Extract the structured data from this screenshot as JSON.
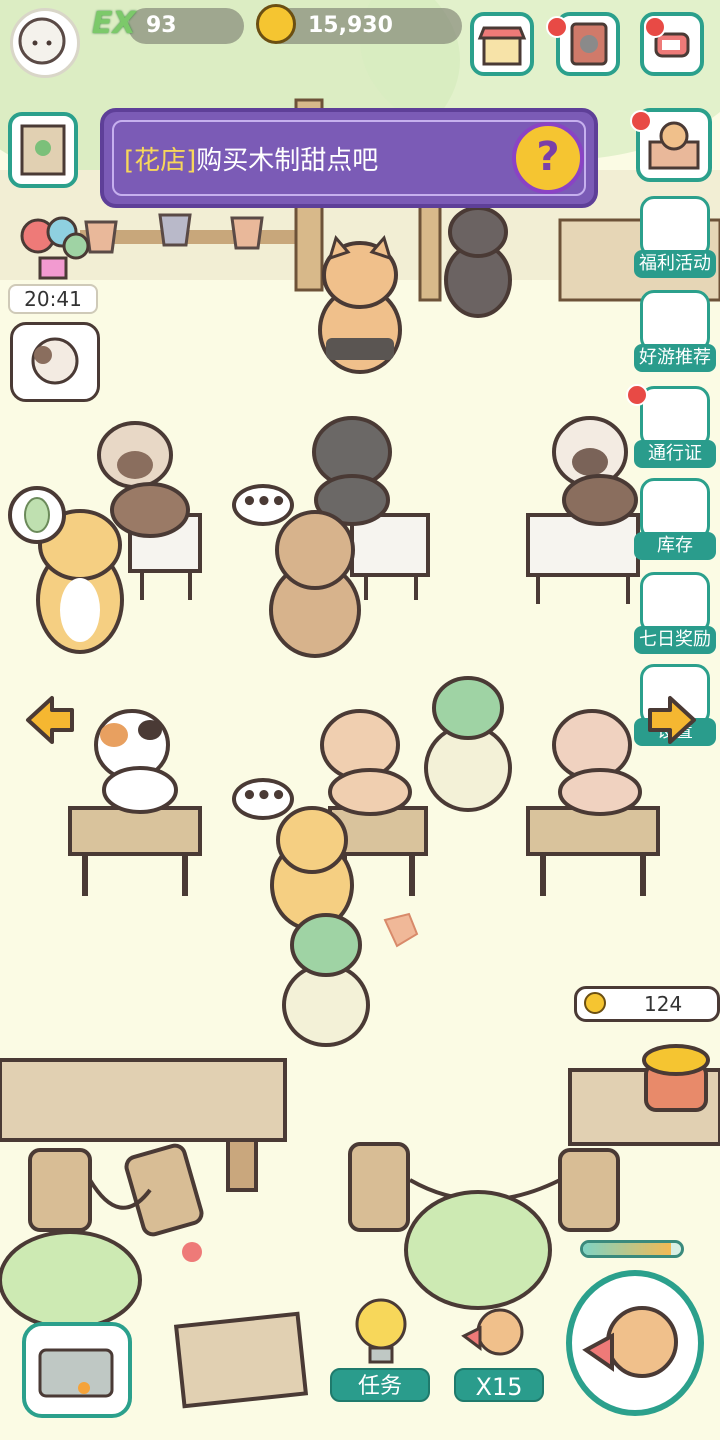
{
  "hud": {
    "ex_badge": "EX",
    "ex_value": "93",
    "coins": "15,930"
  },
  "quest": {
    "tag": "[花店]",
    "text": "购买木制甜点吧",
    "help": "?"
  },
  "timer": "20:41",
  "side_menu": [
    {
      "label": "福利活动",
      "icon": "gift-cat-icon",
      "badge": false
    },
    {
      "label": "好游推荐",
      "icon": "box-cat-icon",
      "badge": false
    },
    {
      "label": "通行证",
      "icon": "pass-ticket-icon",
      "badge": true
    },
    {
      "label": "库存",
      "icon": "backpack-icon",
      "badge": false
    },
    {
      "label": "七日奖励",
      "icon": "calendar-icon",
      "badge": false
    },
    {
      "label": "设置",
      "icon": "gear-icon",
      "badge": false
    }
  ],
  "bubbles": {
    "dots": "•••"
  },
  "coin_pot": {
    "value": "124"
  },
  "energy": {
    "level_percent": 90
  },
  "bottom": {
    "task_label": "任务",
    "multiplier": "X15"
  },
  "colors": {
    "accent": "#2a9c8c",
    "quest_bg": "#7b5bb6",
    "coin": "#f5c531",
    "badge_red": "#e84a45",
    "ground": "#fbfbe4"
  }
}
